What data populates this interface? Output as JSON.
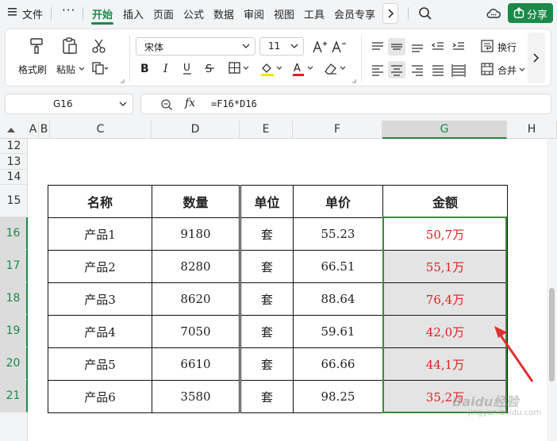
{
  "menubar": {
    "file_label": "文件",
    "more": "···",
    "tabs": [
      "开始",
      "插入",
      "页面",
      "公式",
      "数据",
      "审阅",
      "视图",
      "工具",
      "会员专享"
    ],
    "active_tab": "开始",
    "share_label": "分享"
  },
  "ribbon": {
    "format_painter": "格式刷",
    "paste": "粘贴",
    "font_name": "宋体",
    "font_size": "11",
    "wrap": "换行",
    "merge": "合并"
  },
  "formula_bar": {
    "cell_ref": "G16",
    "fx": "fx",
    "formula": "=F16*D16"
  },
  "sheet": {
    "columns": [
      "A",
      "B",
      "C",
      "D",
      "E",
      "F",
      "G",
      "H"
    ],
    "selected_column": "G",
    "rows": [
      "12",
      "13",
      "14",
      "15",
      "16",
      "17",
      "18",
      "19",
      "20",
      "21"
    ],
    "table_headers": [
      "名称",
      "数量",
      "单位",
      "单价",
      "金额"
    ],
    "table_rows": [
      [
        "产品1",
        "9180",
        "套",
        "55.23",
        "50,7万"
      ],
      [
        "产品2",
        "8280",
        "套",
        "66.51",
        "55,1万"
      ],
      [
        "产品3",
        "8620",
        "套",
        "88.64",
        "76,4万"
      ],
      [
        "产品4",
        "7050",
        "套",
        "59.61",
        "42,0万"
      ],
      [
        "产品5",
        "6610",
        "套",
        "66.66",
        "44,1万"
      ],
      [
        "产品6",
        "3580",
        "套",
        "98.25",
        "35,2万"
      ]
    ]
  },
  "watermark": {
    "brand": "Baidu经验",
    "url": "jingyan.baidu.com"
  },
  "colors": {
    "accent": "#1a8a4a",
    "amount_text": "#e02020",
    "arrow": "#e03030"
  }
}
